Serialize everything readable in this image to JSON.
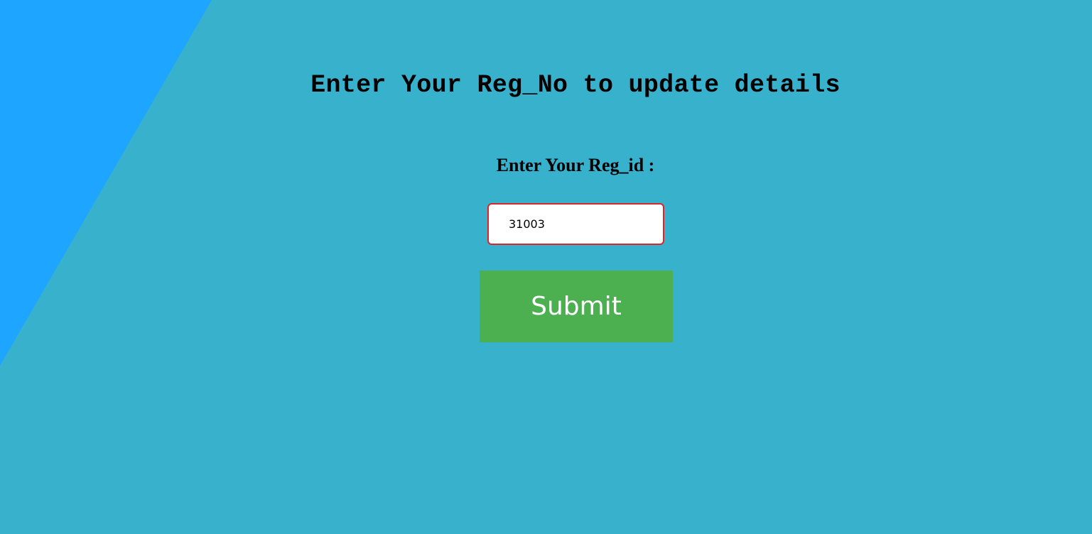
{
  "page": {
    "heading": "Enter Your Reg_No to update details",
    "colors": {
      "background": "#38b2cc",
      "accent_shape": "#1ea5ff",
      "input_border": "#d9262b",
      "button": "#4caf50"
    }
  },
  "form": {
    "reg_label": "Enter Your Reg_id :",
    "reg_value": "31003",
    "submit_label": "Submit"
  }
}
